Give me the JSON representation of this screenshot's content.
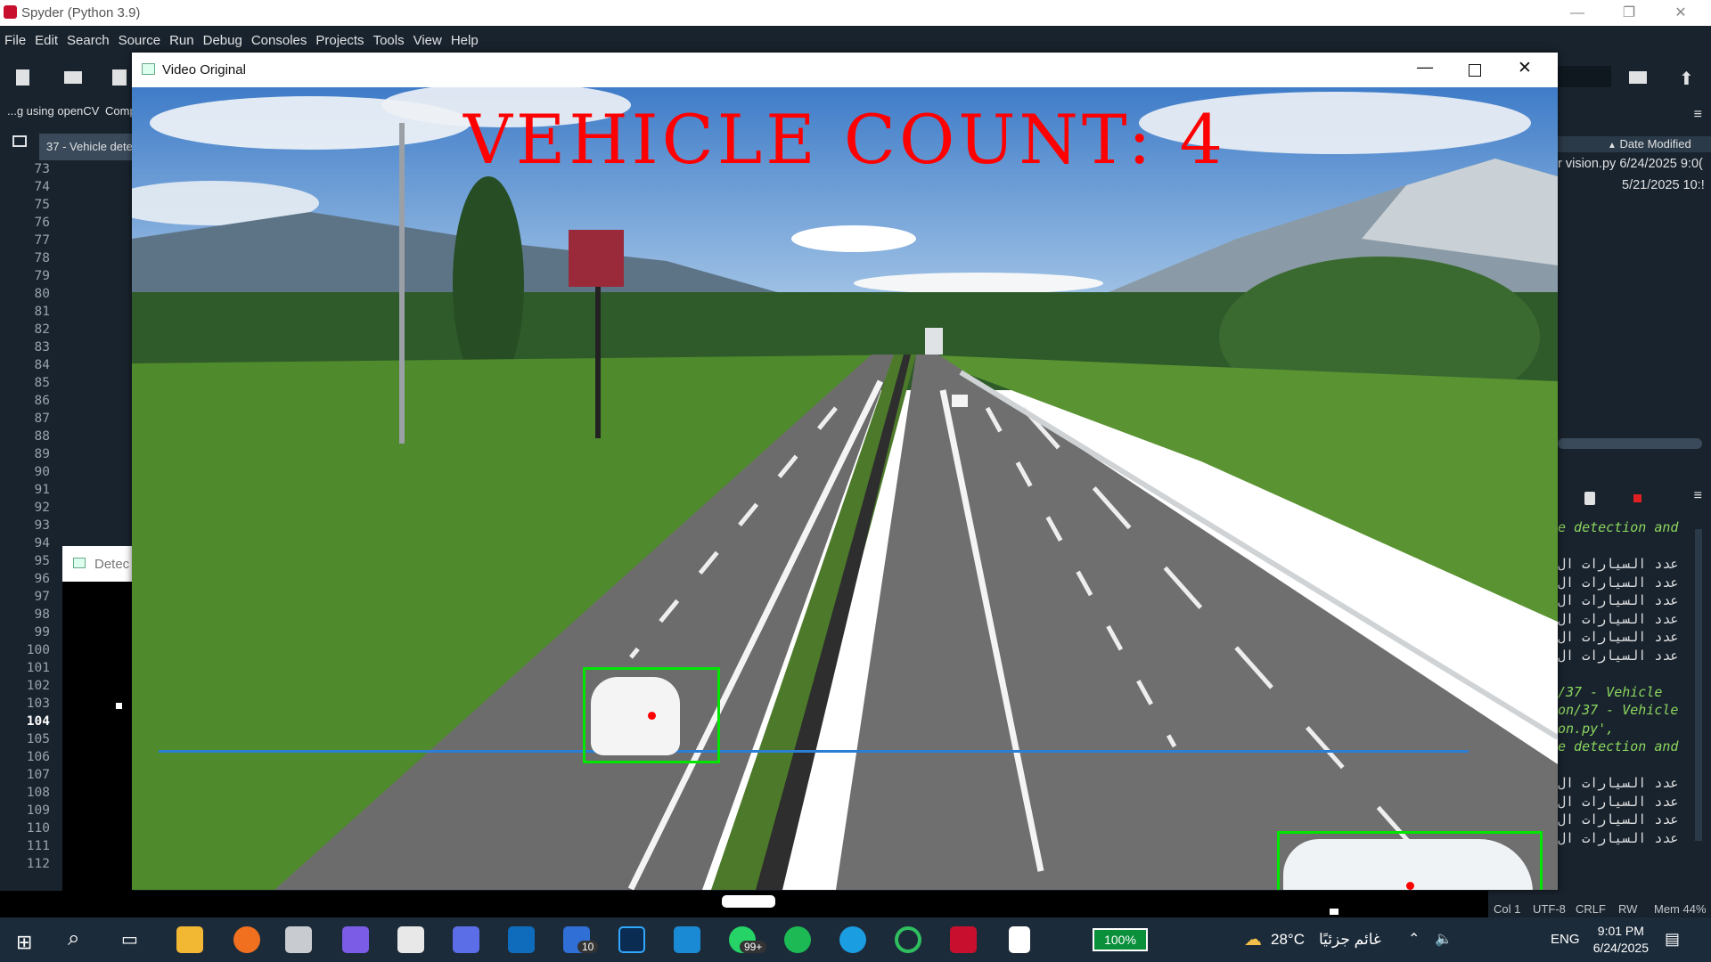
{
  "spyder": {
    "title": "Spyder (Python 3.9)",
    "menu": [
      "File",
      "Edit",
      "Search",
      "Source",
      "Run",
      "Debug",
      "Consoles",
      "Projects",
      "Tools",
      "View",
      "Help"
    ],
    "path_crumb": "...g using openCV",
    "path_crumb2": "Comp",
    "editor_tab": "37 - Vehicle dete",
    "line_numbers": [
      "73",
      "74",
      "75",
      "76",
      "77",
      "78",
      "79",
      "80",
      "81",
      "82",
      "83",
      "84",
      "85",
      "86",
      "87",
      "88",
      "89",
      "90",
      "91",
      "92",
      "93",
      "94",
      "95",
      "96",
      "97",
      "98",
      "99",
      "100",
      "101",
      "102",
      "103",
      "104",
      "105",
      "106",
      "107",
      "108",
      "109",
      "110",
      "111",
      "112"
    ],
    "current_line": "104"
  },
  "files": {
    "col_header": "Date Modified",
    "rows": [
      {
        "name": "r vision.py",
        "date": "6/24/2025 9:0("
      },
      {
        "name": "",
        "date": "5/21/2025 10:!"
      }
    ]
  },
  "console": {
    "lines": [
      {
        "text": "e detection and",
        "kind": "i"
      },
      {
        "text": "",
        "kind": "w"
      },
      {
        "text": "عدد السيارات ال",
        "kind": "w"
      },
      {
        "text": "عدد السيارات ال",
        "kind": "w"
      },
      {
        "text": "عدد السيارات ال",
        "kind": "w"
      },
      {
        "text": "عدد السيارات ال",
        "kind": "w"
      },
      {
        "text": "عدد السيارات ال",
        "kind": "w"
      },
      {
        "text": "عدد السيارات ال",
        "kind": "w"
      },
      {
        "text": "",
        "kind": "w"
      },
      {
        "text": "/37 - Vehicle",
        "kind": "i"
      },
      {
        "text": "on/37 - Vehicle",
        "kind": "i"
      },
      {
        "text": "on.py',",
        "kind": "i"
      },
      {
        "text": "e detection and",
        "kind": "i"
      },
      {
        "text": "",
        "kind": "w"
      },
      {
        "text": "عدد السيارات ال",
        "kind": "w"
      },
      {
        "text": "عدد السيارات ال",
        "kind": "w"
      },
      {
        "text": "عدد السيارات ال",
        "kind": "w"
      },
      {
        "text": "عدد السيارات ال",
        "kind": "w"
      }
    ]
  },
  "detect_window": {
    "title": "Detec"
  },
  "video_window": {
    "title": "Video Original",
    "overlay_text": "VEHICLE COUNT: 4",
    "overlay_color": "#ff0000",
    "box_color": "#00e600",
    "line_color": "#2a7fd4"
  },
  "status": {
    "col": "Col 1",
    "encoding": "UTF-8",
    "eol": "CRLF",
    "rw": "RW",
    "mem": "Mem 44%"
  },
  "taskbar": {
    "battery": "100%",
    "weather_temp": "28°C",
    "weather_text": "غائم جزئيًا",
    "lang": "ENG",
    "time": "9:01 PM",
    "date": "6/24/2025",
    "badge_todo": "10",
    "badge_whatsapp": "99+"
  }
}
